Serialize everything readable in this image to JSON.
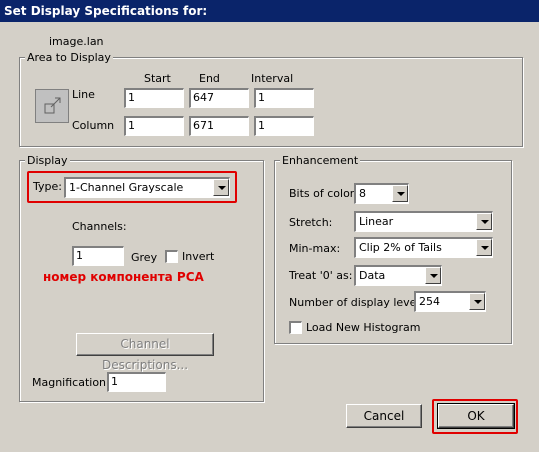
{
  "window": {
    "title": "Set Display Specifications for:"
  },
  "file_name": "image.lan",
  "area": {
    "legend": "Area to Display",
    "col_start": "Start",
    "col_end": "End",
    "col_interval": "Interval",
    "line_label": "Line",
    "line_start": "1",
    "line_end": "647",
    "line_interval": "1",
    "column_label": "Column",
    "column_start": "1",
    "column_end": "671",
    "column_interval": "1"
  },
  "display": {
    "legend": "Display",
    "type_label": "Type:",
    "type_value": "1-Channel Grayscale",
    "channels_label": "Channels:",
    "channel_value": "1",
    "grey_label": "Grey",
    "invert_label": "Invert",
    "annotation": "номер компонента PCA",
    "channel_desc_button": "Channel Descriptions...",
    "magnification_label": "Magnification:",
    "magnification_value": "1"
  },
  "enhancement": {
    "legend": "Enhancement",
    "bits_label": "Bits of color:",
    "bits_value": "8",
    "stretch_label": "Stretch:",
    "stretch_value": "Linear",
    "minmax_label": "Min-max:",
    "minmax_value": "Clip 2% of Tails",
    "treat_label": "Treat '0' as:",
    "treat_value": "Data",
    "levels_label": "Number of display levels:",
    "levels_value": "254",
    "histogram_label": "Load New Histogram"
  },
  "buttons": {
    "cancel": "Cancel",
    "ok": "OK"
  },
  "colors": {
    "title_bar": "#0a246a",
    "dialog_bg": "#d4d0c8",
    "highlight_red": "#e00000"
  }
}
